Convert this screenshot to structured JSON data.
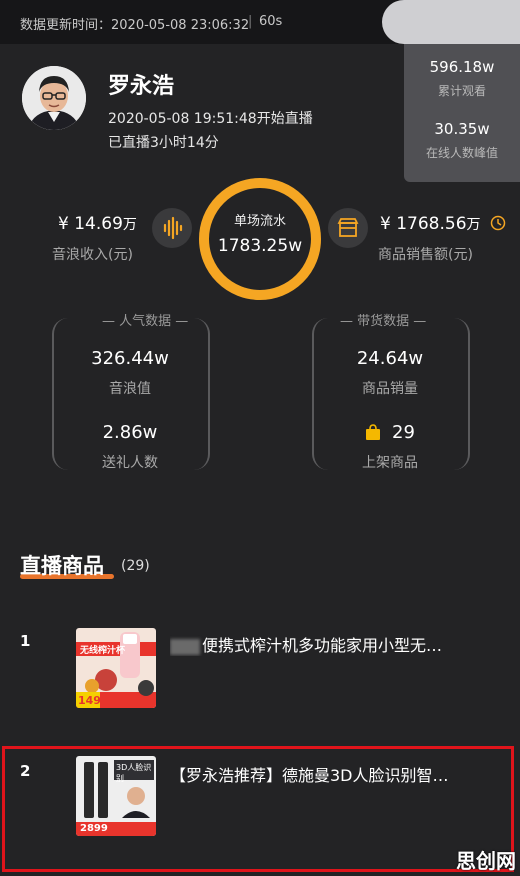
{
  "header": {
    "update_label": "数据更新时间：",
    "update_time": "2020-05-08 23:06:32",
    "separator": "|",
    "refresh_interval": "60s"
  },
  "streamer": {
    "name": "罗永浩",
    "start_text": "2020-05-08 19:51:48开始直播",
    "duration_text": "已直播3小时14分"
  },
  "viewer_stats": {
    "total_views_value": "596.18w",
    "total_views_label": "累计观看",
    "peak_online_value": "30.35w",
    "peak_online_label": "在线人数峰值"
  },
  "turnover": {
    "title": "单场流水",
    "value": "1783.25w",
    "progress": 1.0,
    "ring_color": "#f5a623"
  },
  "sound_income": {
    "prefix": "¥",
    "value": "14.69",
    "unit": "万",
    "label": "音浪收入(元)",
    "icon": "soundwave-icon",
    "icon_color": "#f5a623"
  },
  "sales_amount": {
    "prefix": "¥",
    "value": "1768.56",
    "unit": "万",
    "label": "商品销售额(元)",
    "icon": "shop-icon",
    "icon_color": "#f5a623"
  },
  "popularity_card": {
    "title": "人气数据",
    "sound_value": "326.44w",
    "sound_label": "音浪值",
    "gift_value": "2.86w",
    "gift_label": "送礼人数"
  },
  "sales_card": {
    "title": "带货数据",
    "sold_value": "24.64w",
    "sold_label": "商品销量",
    "listed_value": "29",
    "listed_label": "上架商品",
    "bag_icon_color": "#f5b800"
  },
  "products_section": {
    "title": "直播商品",
    "count": "(29)",
    "accent_color": "#e8742c"
  },
  "products": [
    {
      "rank": "1",
      "title": "便携式榨汁机多功能家用小型无…",
      "thumb_banner": "无线榨汁杯",
      "thumb_price": "149"
    },
    {
      "rank": "2",
      "title": "【罗永浩推荐】德施曼3D人脸识别智…",
      "thumb_banner": "3D人脸识别",
      "thumb_price": "2899"
    }
  ],
  "watermark": "思创网"
}
